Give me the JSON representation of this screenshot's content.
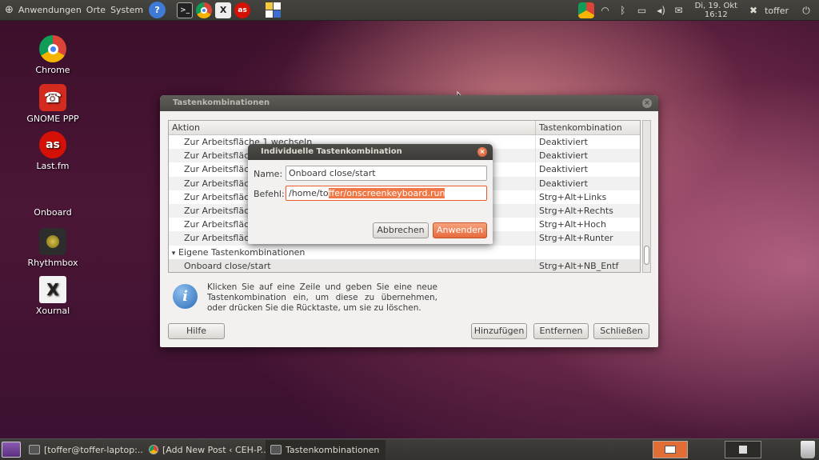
{
  "top_panel": {
    "menus": [
      "Anwendungen",
      "Orte",
      "System"
    ],
    "clock": {
      "date": "Di, 19. Okt",
      "time": "16:12"
    },
    "user": "toffer"
  },
  "desktop_icons": [
    {
      "label": "Chrome"
    },
    {
      "label": "GNOME PPP"
    },
    {
      "label": "Last.fm"
    },
    {
      "label": "Onboard"
    },
    {
      "label": "Rhythmbox"
    },
    {
      "label": "Xournal"
    }
  ],
  "main_window": {
    "title": "Tastenkombinationen",
    "columns": [
      "Aktion",
      "Tastenkombination"
    ],
    "rows": [
      {
        "action": "Zur Arbeitsfläche 1 wechseln",
        "shortcut": "Deaktiviert"
      },
      {
        "action": "Zur Arbeitsfläch",
        "shortcut": "Deaktiviert"
      },
      {
        "action": "Zur Arbeitsfläch",
        "shortcut": "Deaktiviert"
      },
      {
        "action": "Zur Arbeitsfläch",
        "shortcut": "Deaktiviert"
      },
      {
        "action": "Zur Arbeitsfläch",
        "shortcut": "Strg+Alt+Links"
      },
      {
        "action": "Zur Arbeitsfläch",
        "shortcut": "Strg+Alt+Rechts"
      },
      {
        "action": "Zur Arbeitsfläch",
        "shortcut": "Strg+Alt+Hoch"
      },
      {
        "action": "Zur Arbeitsfläch",
        "shortcut": "Strg+Alt+Runter"
      }
    ],
    "group": {
      "label": "Eigene Tastenkombinationen",
      "expander": "▾"
    },
    "custom_rows": [
      {
        "action": "Onboard close/start",
        "shortcut": "Strg+Alt+NB_Entf"
      }
    ],
    "info_text": "Klicken Sie auf eine Zeile und geben Sie eine neue Tastenkombination ein, um diese zu übernehmen, oder drücken Sie die Rücktaste, um sie zu löschen.",
    "buttons": {
      "help": "Hilfe",
      "add": "Hinzufügen",
      "remove": "Entfernen",
      "close": "Schließen"
    }
  },
  "dialog": {
    "title": "Individuelle Tastenkombination",
    "name_label": "Name:",
    "name_value": "Onboard close/start",
    "command_label": "Befehl:",
    "command_prefix": "/home/to",
    "command_selected": "ffer/onscreenkeyboard.run",
    "buttons": {
      "cancel": "Abbrechen",
      "apply": "Anwenden"
    }
  },
  "taskbar": {
    "tasks": [
      {
        "label": "[toffer@toffer-laptop:..."
      },
      {
        "label": "[Add New Post ‹ CEH-P..."
      },
      {
        "label": "Tastenkombinationen"
      }
    ]
  },
  "colors": {
    "accent": "#f07746",
    "panel": "#3c3b37"
  }
}
